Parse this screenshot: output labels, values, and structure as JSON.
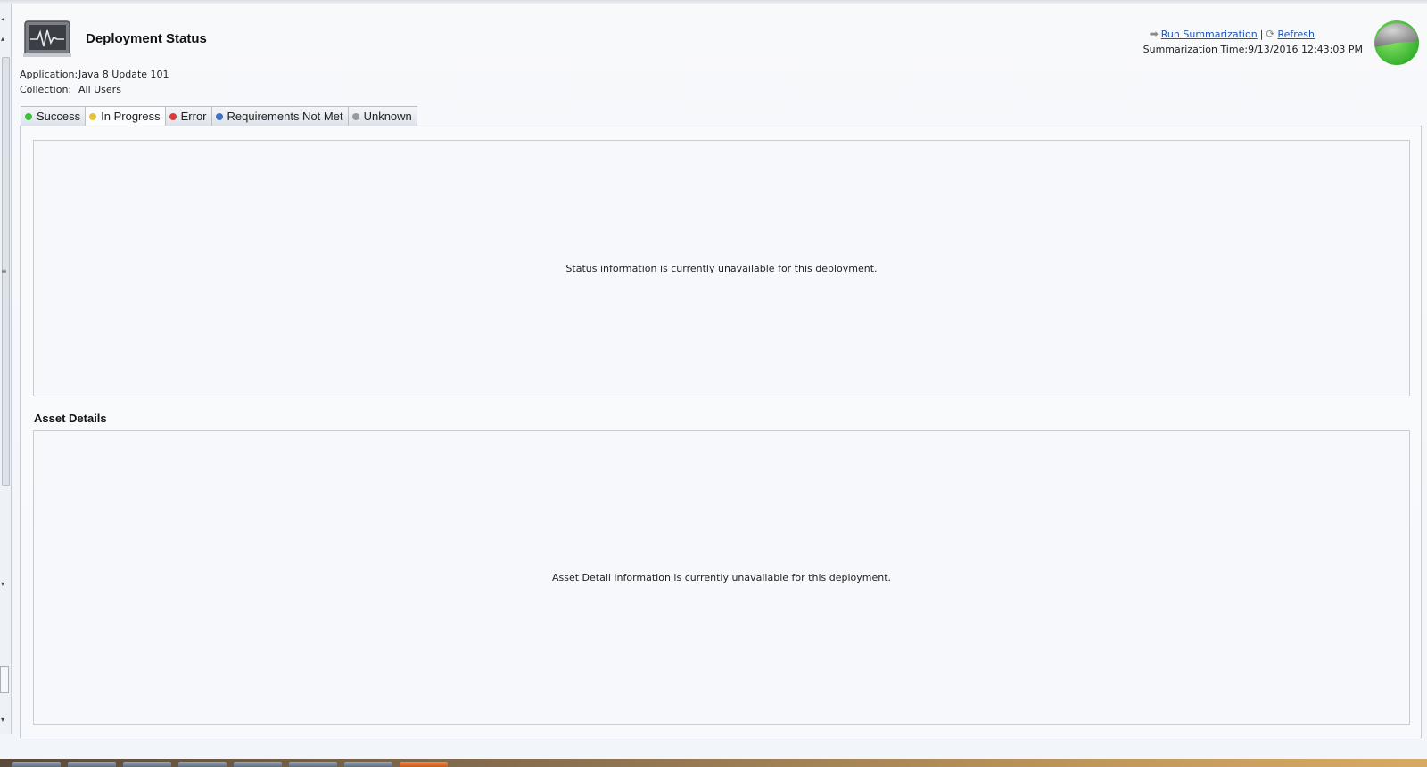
{
  "header": {
    "title": "Deployment Status",
    "application_label": "Application:",
    "application_value": "Java 8 Update 101",
    "collection_label": "Collection:",
    "collection_value": "All Users"
  },
  "actions": {
    "run_summarization": "Run Summarization",
    "separator": "|",
    "refresh": "Refresh",
    "summarization_time_label": "Summarization Time:",
    "summarization_time_value": "9/13/2016 12:43:03 PM"
  },
  "tabs": [
    {
      "label": "Success",
      "color": "#3cc23a"
    },
    {
      "label": "In Progress",
      "color": "#e2c33a"
    },
    {
      "label": "Error",
      "color": "#d93a3a"
    },
    {
      "label": "Requirements Not Met",
      "color": "#3f6fc4"
    },
    {
      "label": "Unknown",
      "color": "#9a9a9a"
    }
  ],
  "active_tab": "In Progress",
  "status_panel": {
    "message": "Status information is currently unavailable for this deployment."
  },
  "asset_details": {
    "title": "Asset Details",
    "message": "Asset Detail information is currently unavailable for this deployment."
  },
  "colors": {
    "link": "#1d56b8",
    "pie_green": "#3dc23a",
    "pie_gray": "#8e8e8e"
  },
  "icons": [
    "monitor-icon",
    "run-arrow-icon",
    "refresh-icon",
    "status-pie-icon"
  ]
}
